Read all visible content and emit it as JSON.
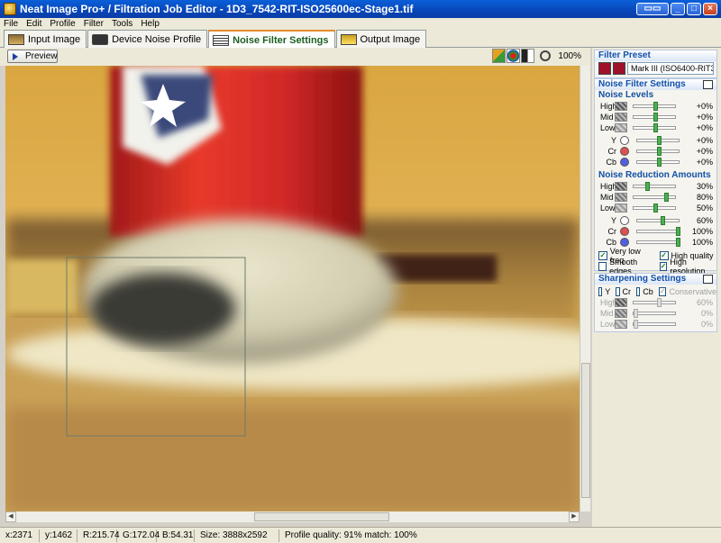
{
  "window": {
    "title": "Neat Image Pro+ / Filtration Job Editor - 1D3_7542-RIT-ISO25600ec-Stage1.tif"
  },
  "menu": [
    "File",
    "Edit",
    "Profile",
    "Filter",
    "Tools",
    "Help"
  ],
  "tabs": [
    {
      "label": "Input Image"
    },
    {
      "label": "Device Noise Profile"
    },
    {
      "label": "Noise Filter Settings"
    },
    {
      "label": "Output Image"
    }
  ],
  "toolbar": {
    "preview_label": "Preview",
    "zoom": "100%"
  },
  "panel": {
    "filter_preset_title": "Filter Preset",
    "preset_value": "Mark III (ISO6400-RIT31-S",
    "noise_filter_settings_title": "Noise Filter Settings",
    "noise_levels_title": "Noise Levels",
    "noise_levels": [
      {
        "label": "High",
        "value": "+0%",
        "level": 0.5
      },
      {
        "label": "Mid",
        "value": "+0%",
        "level": 0.5
      },
      {
        "label": "Low",
        "value": "+0%",
        "level": 0.5
      },
      {
        "label": "Y",
        "value": "+0%",
        "level": 0.5,
        "color": "#ffffff"
      },
      {
        "label": "Cr",
        "value": "+0%",
        "level": 0.5,
        "color": "#e05050"
      },
      {
        "label": "Cb",
        "value": "+0%",
        "level": 0.5,
        "color": "#5060e0"
      }
    ],
    "reduction_title": "Noise Reduction Amounts",
    "reduction": [
      {
        "label": "High",
        "value": "30%",
        "level": 0.3
      },
      {
        "label": "Mid",
        "value": "80%",
        "level": 0.8
      },
      {
        "label": "Low",
        "value": "50%",
        "level": 0.5
      },
      {
        "label": "Y",
        "value": "60%",
        "level": 0.6,
        "color": "#ffffff"
      },
      {
        "label": "Cr",
        "value": "100%",
        "level": 1.0,
        "color": "#e05050"
      },
      {
        "label": "Cb",
        "value": "100%",
        "level": 1.0,
        "color": "#5060e0"
      }
    ],
    "options": [
      {
        "label": "Very low freq",
        "checked": true
      },
      {
        "label": "High quality",
        "checked": true
      },
      {
        "label": "Smooth edges",
        "checked": false
      },
      {
        "label": "High resolution",
        "checked": true
      }
    ],
    "sharpening_title": "Sharpening Settings",
    "sharpening_channels": [
      {
        "label": "Y",
        "checked": false
      },
      {
        "label": "Cr",
        "checked": false
      },
      {
        "label": "Cb",
        "checked": false
      },
      {
        "label": "Conservative",
        "checked": true
      }
    ],
    "sharpening": [
      {
        "label": "High",
        "value": "60%",
        "level": 0.6
      },
      {
        "label": "Mid",
        "value": "0%",
        "level": 0.0
      },
      {
        "label": "Low",
        "value": "0%",
        "level": 0.0
      }
    ]
  },
  "status": {
    "x": "x:2371",
    "y": "y:1462",
    "r": "R:215.74",
    "g": "G:172.04",
    "b": "B:54.31",
    "size": "Size: 3888x2592",
    "quality": "Profile quality: 91%  match: 100%"
  }
}
